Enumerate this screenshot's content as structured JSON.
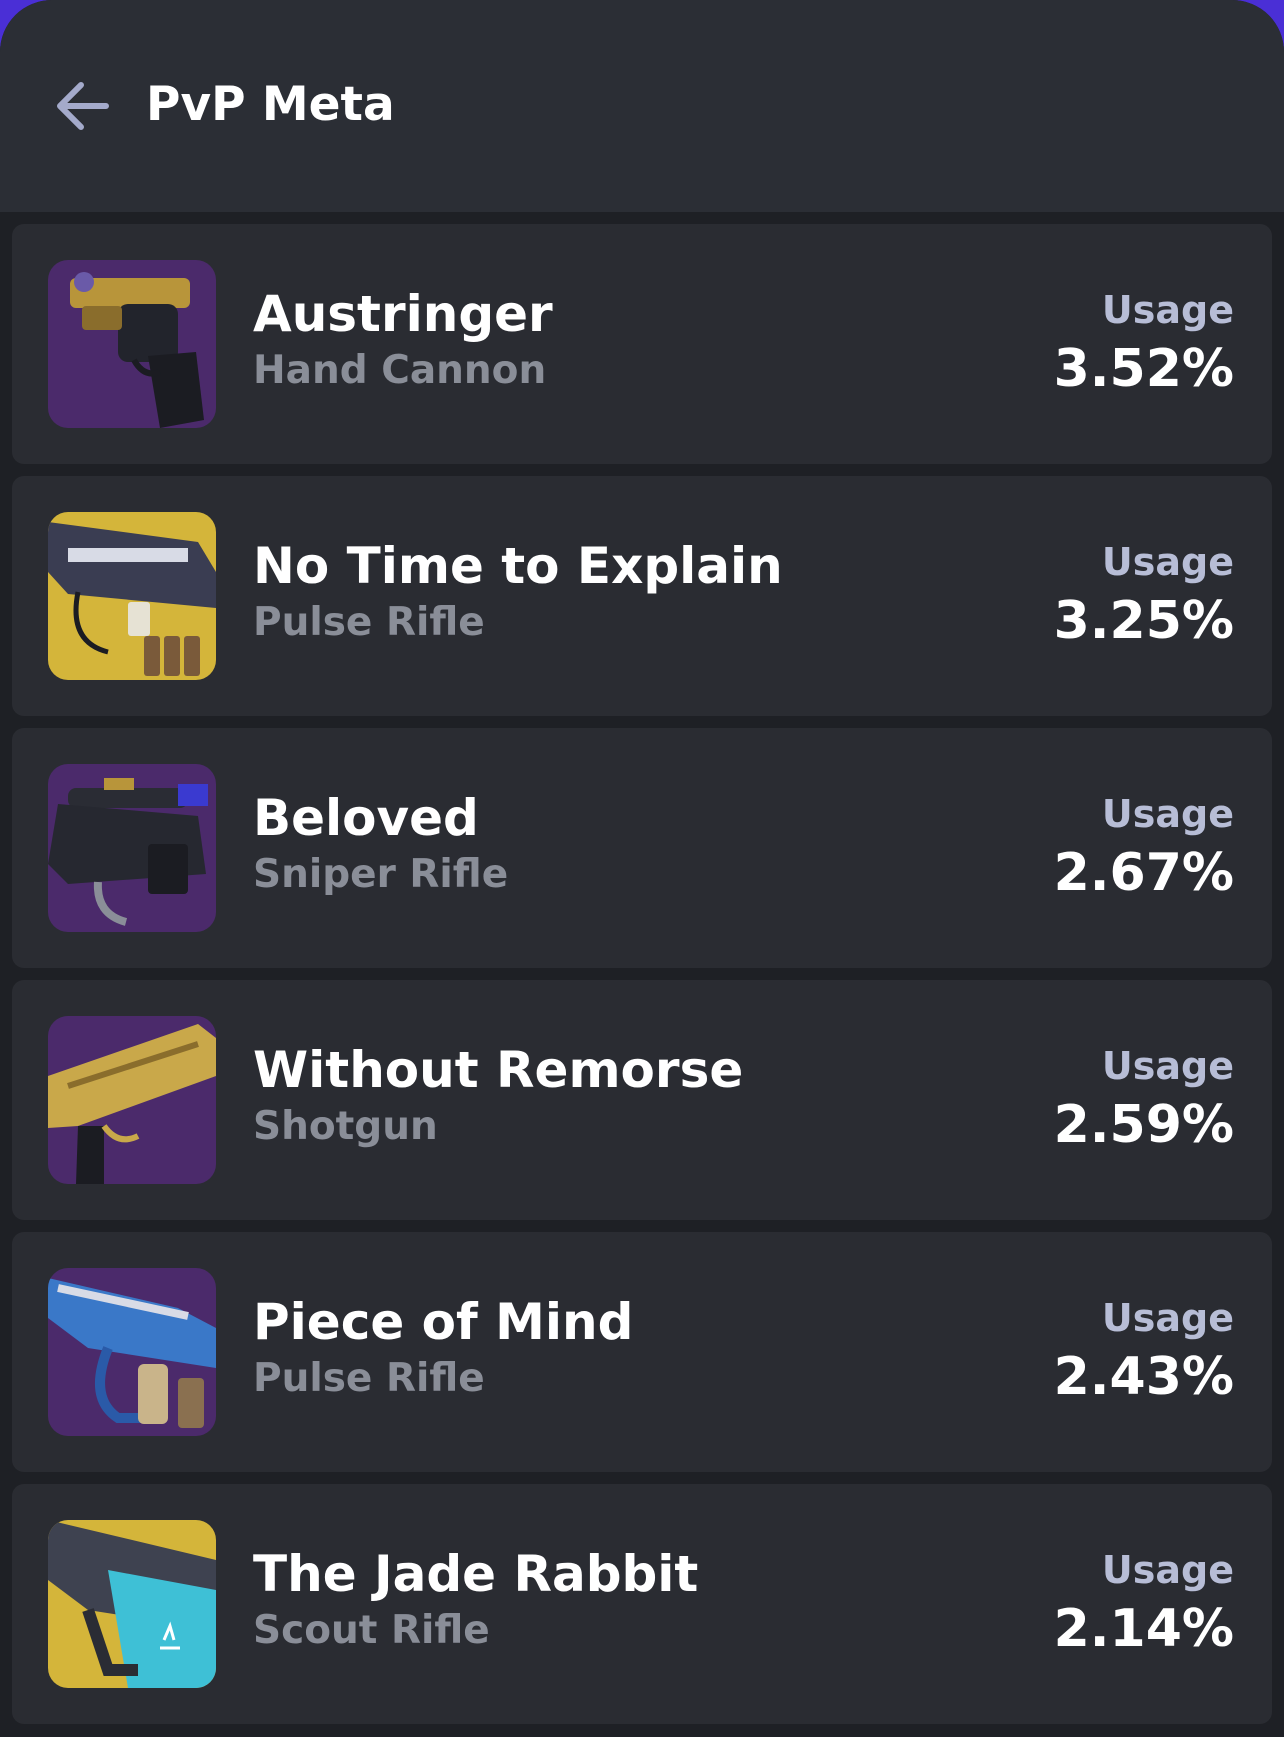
{
  "header": {
    "title": "PvP Meta",
    "back_icon": "arrow-left-icon"
  },
  "colors": {
    "app_background": "#1e2025",
    "header_background": "#2b2e35",
    "card_background": "#2a2c32",
    "purple_thumb": "#4b2a6b",
    "yellow_thumb": "#d4b53a",
    "usage_label": "#b7bdd6",
    "subtitle": "#8a8e98"
  },
  "weapons": [
    {
      "name": "Austringer",
      "type": "Hand Cannon",
      "usage_label": "Usage",
      "usage": "3.52%",
      "icon": "hand-cannon-icon",
      "thumb_color": "#4b2a6b"
    },
    {
      "name": "No Time to Explain",
      "type": "Pulse Rifle",
      "usage_label": "Usage",
      "usage": "3.25%",
      "icon": "pulse-rifle-icon",
      "thumb_color": "#d4b53a"
    },
    {
      "name": "Beloved",
      "type": "Sniper Rifle",
      "usage_label": "Usage",
      "usage": "2.67%",
      "icon": "sniper-rifle-icon",
      "thumb_color": "#4b2a6b"
    },
    {
      "name": "Without Remorse",
      "type": "Shotgun",
      "usage_label": "Usage",
      "usage": "2.59%",
      "icon": "shotgun-icon",
      "thumb_color": "#4b2a6b"
    },
    {
      "name": "Piece of Mind",
      "type": "Pulse Rifle",
      "usage_label": "Usage",
      "usage": "2.43%",
      "icon": "pulse-rifle-icon",
      "thumb_color": "#4b2a6b"
    },
    {
      "name": "The Jade Rabbit",
      "type": "Scout Rifle",
      "usage_label": "Usage",
      "usage": "2.14%",
      "icon": "scout-rifle-icon",
      "thumb_color": "#d4b53a"
    }
  ]
}
